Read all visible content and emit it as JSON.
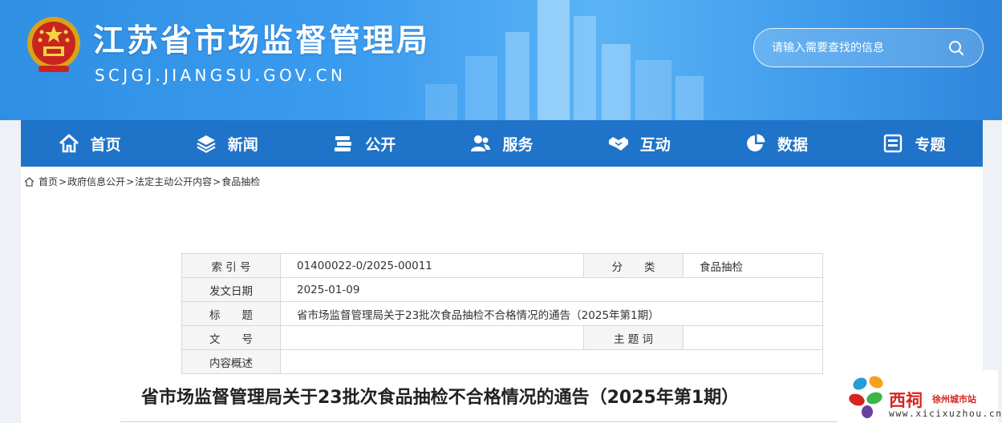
{
  "header": {
    "site_title": "江苏省市场监督管理局",
    "site_domain": "SCJGJ.JIANGSU.GOV.CN",
    "emblem_icon": "national-emblem-icon",
    "search": {
      "placeholder": "请输入需要查找的信息",
      "icon": "search-icon"
    },
    "colors": {
      "banner": "#3b9bef",
      "text": "#ffffff"
    }
  },
  "nav": {
    "items": [
      {
        "label": "首页",
        "icon": "home-icon"
      },
      {
        "label": "新闻",
        "icon": "layers-icon"
      },
      {
        "label": "公开",
        "icon": "books-icon"
      },
      {
        "label": "服务",
        "icon": "users-icon"
      },
      {
        "label": "互动",
        "icon": "handshake-icon"
      },
      {
        "label": "数据",
        "icon": "pie-chart-icon"
      },
      {
        "label": "专题",
        "icon": "topic-icon"
      }
    ],
    "color": "#1f73c8"
  },
  "breadcrumb": {
    "items": [
      "首页",
      "政府信息公开",
      "法定主动公开内容",
      "食品抽检"
    ],
    "separator": ">"
  },
  "meta_table": {
    "index_label": "索 引 号",
    "index_value": "01400022-0/2025-00011",
    "category_label": "分　　类",
    "category_value": "食品抽检",
    "date_label": "发文日期",
    "date_value": "2025-01-09",
    "title_label": "标　　题",
    "title_value": "省市场监督管理局关于23批次食品抽检不合格情况的通告（2025年第1期）",
    "docno_label": "文　　号",
    "docno_value": "",
    "subject_label": "主 题 词",
    "subject_value": "",
    "summary_label": "内容概述",
    "summary_value": ""
  },
  "document": {
    "title": "省市场监督管理局关于23批次食品抽检不合格情况的通告（2025年第1期）"
  },
  "watermark": {
    "brand": "西祠",
    "sub": "徐州城市站",
    "url": "www.xicixuzhou.cn",
    "color": "#d8241f"
  }
}
